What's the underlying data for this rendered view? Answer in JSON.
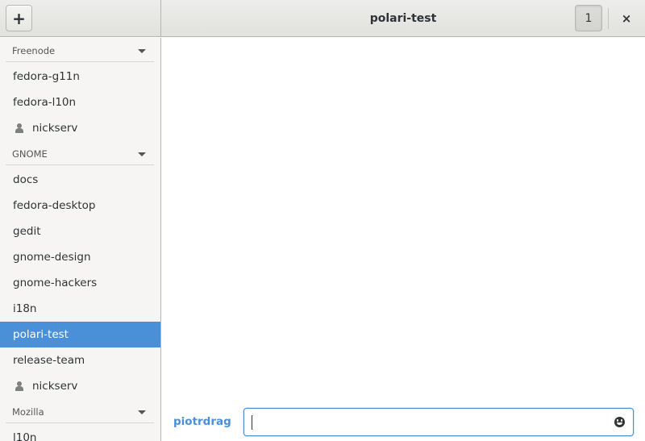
{
  "header": {
    "add_label": "+",
    "title": "polari-test",
    "user_count": "1",
    "close_label": "×"
  },
  "sidebar": {
    "networks": [
      {
        "name": "Freenode",
        "rooms": [
          {
            "label": "fedora-g11n",
            "type": "channel"
          },
          {
            "label": "fedora-l10n",
            "type": "channel"
          },
          {
            "label": "nickserv",
            "type": "user"
          }
        ]
      },
      {
        "name": "GNOME",
        "rooms": [
          {
            "label": "docs",
            "type": "channel"
          },
          {
            "label": "fedora-desktop",
            "type": "channel"
          },
          {
            "label": "gedit",
            "type": "channel"
          },
          {
            "label": "gnome-design",
            "type": "channel"
          },
          {
            "label": "gnome-hackers",
            "type": "channel"
          },
          {
            "label": "i18n",
            "type": "channel"
          },
          {
            "label": "polari-test",
            "type": "channel",
            "selected": true
          },
          {
            "label": "release-team",
            "type": "channel"
          },
          {
            "label": "nickserv",
            "type": "user"
          }
        ]
      },
      {
        "name": "Mozilla",
        "rooms": [
          {
            "label": "l10n",
            "type": "channel"
          }
        ]
      }
    ]
  },
  "composer": {
    "nick": "piotrdrag",
    "entry_value": "",
    "emoji_icon": "face-smile-icon"
  },
  "colors": {
    "accent": "#4a90d9",
    "sidebar_bg": "#f6f5f4",
    "text": "#2e3436"
  }
}
